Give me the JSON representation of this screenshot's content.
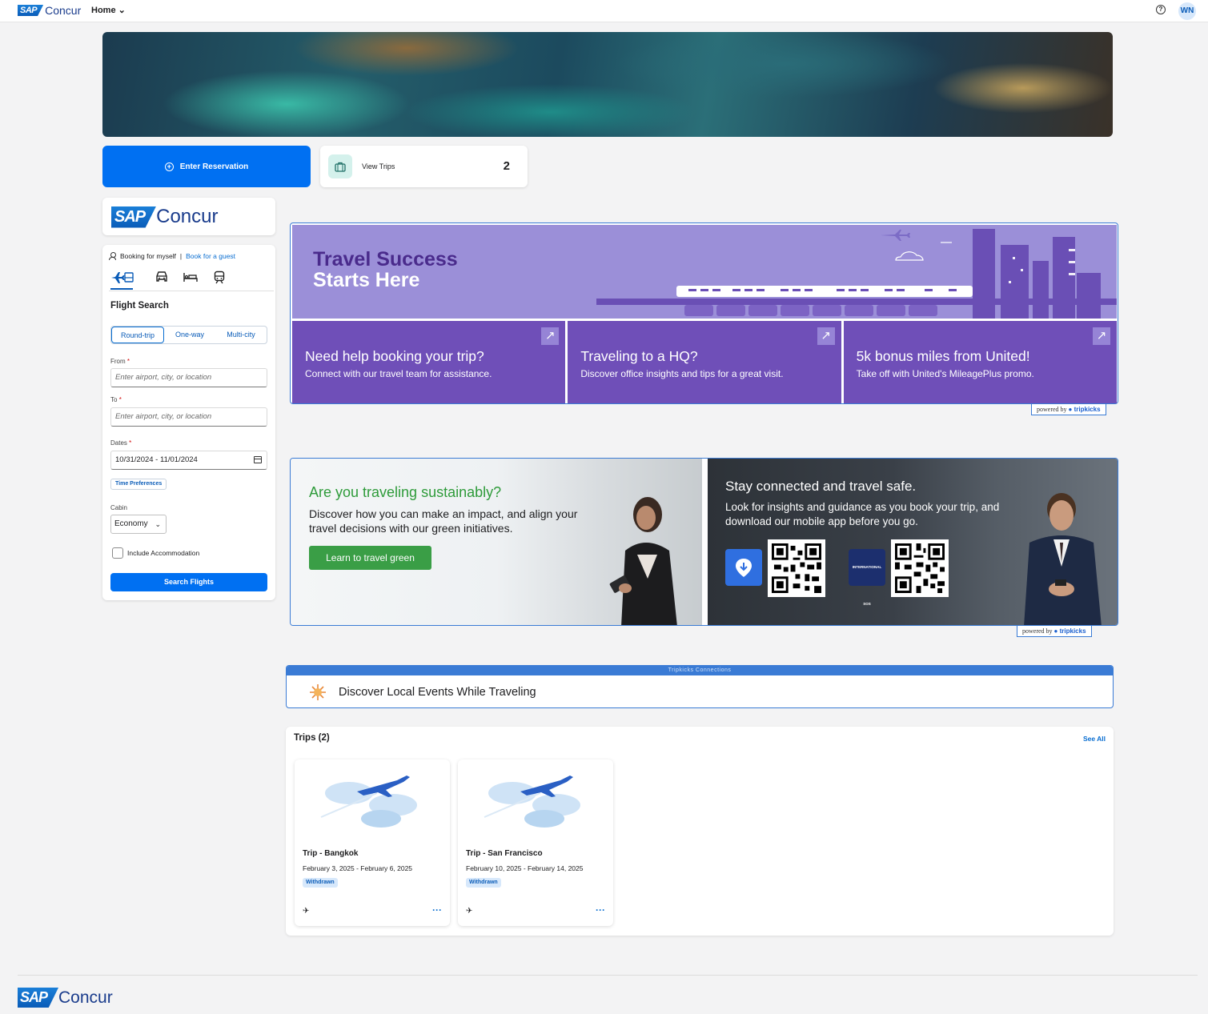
{
  "topbar": {
    "logo_sap": "SAP",
    "logo_concur": "Concur",
    "home_label": "Home",
    "home_chevron": "⌄",
    "help_icon": "?",
    "avatar_initials": "WN"
  },
  "actions": {
    "enter_reservation": "Enter Reservation",
    "view_trips_label": "View Trips",
    "view_trips_count": "2"
  },
  "brand": {
    "sap": "SAP",
    "concur": "Concur"
  },
  "booking": {
    "for_myself": "Booking for myself",
    "separator": "|",
    "for_guest": "Book for a guest",
    "tabs": [
      {
        "icon": "flight-hotel-icon",
        "glyph": "✈"
      },
      {
        "icon": "car-icon",
        "glyph": "🚘"
      },
      {
        "icon": "hotel-icon",
        "glyph": "🛏"
      },
      {
        "icon": "train-icon",
        "glyph": "🚆"
      }
    ],
    "title": "Flight Search",
    "trip_types": [
      "Round-trip",
      "One-way",
      "Multi-city"
    ],
    "from_label": "From",
    "from_placeholder": "Enter airport, city, or location",
    "to_label": "To",
    "to_placeholder": "Enter airport, city, or location",
    "dates_label": "Dates",
    "dates_value": "10/31/2024 - 11/01/2024",
    "required_mark": "*",
    "time_preferences": "Time Preferences",
    "cabin_label": "Cabin",
    "cabin_value": "Economy",
    "include_accommodation": "Include Accommodation",
    "search_button": "Search Flights"
  },
  "promo": {
    "title_line1": "Travel Success",
    "title_line2": "Starts Here",
    "tiles": [
      {
        "title": "Need help booking your trip?",
        "subtitle": "Connect with our travel team for assistance."
      },
      {
        "title": "Traveling to a HQ?",
        "subtitle": "Discover office insights and tips for a great visit."
      },
      {
        "title": "5k bonus miles from United!",
        "subtitle": "Take off with United's MileagePlus promo."
      }
    ],
    "ext_arrow": "↗",
    "powered_by": "powered by",
    "powered_brand": "tripkicks"
  },
  "green": {
    "title": "Are you traveling sustainably?",
    "text": "Discover how you can make an impact, and align your travel decisions with our green initiatives.",
    "button": "Learn to travel green"
  },
  "safety": {
    "title": "Stay connected and travel safe.",
    "text": "Look for insights and guidance as you book your trip, and download our mobile app before you go.",
    "sos_label": "INTERNATIONAL SOS"
  },
  "connections": {
    "bar_label": "Tripkicks Connections",
    "label": "Discover Local Events While Traveling"
  },
  "trips": {
    "title": "Trips (2)",
    "see_all": "See All",
    "items": [
      {
        "name": "Trip - Bangkok",
        "dates": "February 3, 2025 - February 6, 2025",
        "status": "Withdrawn"
      },
      {
        "name": "Trip - San Francisco",
        "dates": "February 10, 2025 - February 14, 2025",
        "status": "Withdrawn"
      }
    ],
    "plane_glyph": "✈",
    "more_glyph": "···"
  },
  "footer": {
    "sap": "SAP",
    "concur": "Concur"
  },
  "colors": {
    "primary_blue": "#0070f2",
    "promo_purple": "#6f4fb8",
    "promo_lavender": "#9b8fd8",
    "green": "#3a9e46",
    "border_blue": "#3a7bd5"
  }
}
